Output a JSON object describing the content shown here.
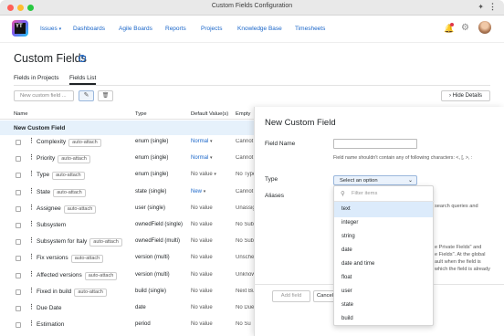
{
  "window": {
    "title": "Custom Fields Configuration"
  },
  "nav": {
    "logo_text": "YT",
    "items": [
      "Issues",
      "Dashboards",
      "Agile Boards",
      "Reports",
      "Projects",
      "Knowledge Base",
      "Timesheets"
    ],
    "issues_caret": "▾"
  },
  "page": {
    "title": "Custom Fields",
    "help_icon": "?",
    "tabs": [
      "Fields in Projects",
      "Fields List"
    ],
    "active_tab": "Fields List"
  },
  "toolbar": {
    "new_field_placeholder": "New custom field ...",
    "edit_icon": "✎",
    "delete_icon": "🗑",
    "hide_details_label": "Hide Details",
    "hide_details_caret": "›"
  },
  "table": {
    "columns": [
      "Name",
      "Type",
      "Default Value(s)",
      "Empty"
    ],
    "new_row_label": "New Custom Field",
    "rows": [
      {
        "name": "Complexity",
        "attach": "auto-attach",
        "type": "enum (single)",
        "default": "Normal",
        "default_caret": "▾",
        "empty": "Cannot"
      },
      {
        "name": "Priority",
        "attach": "auto-attach",
        "type": "enum (single)",
        "default": "Normal",
        "default_caret": "▾",
        "empty": "Cannot"
      },
      {
        "name": "Type",
        "attach": "auto-attach",
        "type": "enum (single)",
        "default": "No value",
        "default_caret": "▾",
        "empty": "No Type"
      },
      {
        "name": "State",
        "attach": "auto-attach",
        "type": "state (single)",
        "default": "New",
        "default_caret": "▾",
        "empty": "Cannot"
      },
      {
        "name": "Assignee",
        "attach": "auto-attach",
        "type": "user (single)",
        "default": "No value",
        "default_caret": "",
        "empty": "Unassigned"
      },
      {
        "name": "Subsystem",
        "attach": "",
        "type": "ownedField (single)",
        "default": "No value",
        "default_caret": "",
        "empty": "No Subsystem"
      },
      {
        "name": "Subsystem for Italy",
        "attach": "auto-attach",
        "type": "ownedField (multi)",
        "default": "No value",
        "default_caret": "",
        "empty": "No Subsystem"
      },
      {
        "name": "Fix versions",
        "attach": "auto-attach",
        "type": "version (multi)",
        "default": "No value",
        "default_caret": "",
        "empty": "Unscheduled"
      },
      {
        "name": "Affected versions",
        "attach": "auto-attach",
        "type": "version (multi)",
        "default": "No value",
        "default_caret": "",
        "empty": "Unknown"
      },
      {
        "name": "Fixed in build",
        "attach": "auto-attach",
        "type": "build (single)",
        "default": "No value",
        "default_caret": "",
        "empty": "Next Build"
      },
      {
        "name": "Due Date",
        "attach": "",
        "type": "date",
        "default": "No value",
        "default_caret": "",
        "empty": "No Due"
      },
      {
        "name": "Estimation",
        "attach": "",
        "type": "period",
        "default": "No value",
        "default_caret": "",
        "empty": "No Su"
      }
    ]
  },
  "panel": {
    "title": "New Custom Field",
    "field_name_label": "Field Name",
    "field_name_value": "",
    "field_name_hint": "Field name shouldn't contain any of following characters: <, [, >, :",
    "type_label": "Type",
    "type_select_value": "Select an option",
    "type_select_caret": "⌄",
    "aliases_label": "Aliases",
    "bg_text_1": "search queries and",
    "bg_text_2": "e Private Fields\" and",
    "bg_text_3": "e Fields\". At the global",
    "bg_text_4": "ault when the field is",
    "bg_text_5": "which the field is already",
    "dropdown": {
      "filter_placeholder": "Filter items",
      "options": [
        "text",
        "integer",
        "string",
        "date",
        "date and time",
        "float",
        "user",
        "state",
        "build"
      ],
      "highlighted": "text"
    },
    "add_button": "Add field",
    "cancel_button": "Cancel"
  },
  "colors": {
    "accent": "#1a66c9",
    "selection": "#dcebfb",
    "new_row": "#e6f1fb",
    "notification": "#e0364a"
  }
}
